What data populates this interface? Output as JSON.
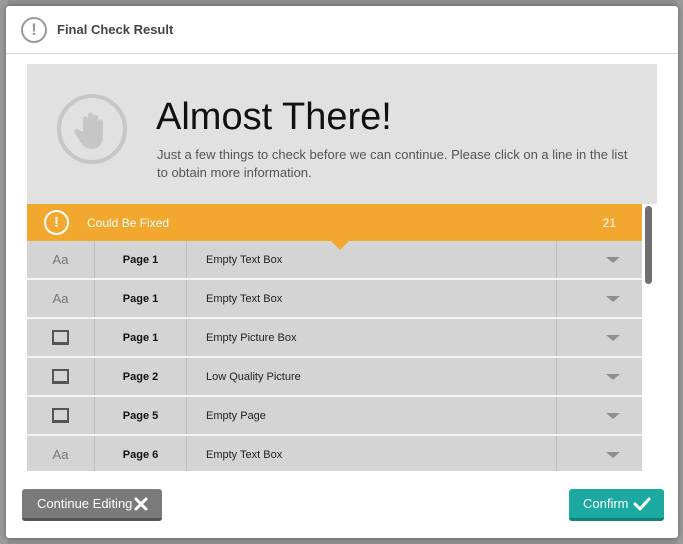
{
  "dialog": {
    "title": "Final Check Result",
    "title_icon": "exclamation-circle-icon"
  },
  "hero": {
    "heading": "Almost There!",
    "subtitle": "Just a few things to check before we can continue. Please click on a line in the list to obtain more information.",
    "icon": "stop-hand-icon"
  },
  "group": {
    "label": "Could Be Fixed",
    "count": "21",
    "icon": "exclamation-circle-icon",
    "color": "#f2a72e"
  },
  "rows": [
    {
      "type": "text",
      "type_label": "Aa",
      "page": "Page 1",
      "description": "Empty Text Box"
    },
    {
      "type": "text",
      "type_label": "Aa",
      "page": "Page 1",
      "description": "Empty Text Box"
    },
    {
      "type": "picture",
      "type_label": "",
      "page": "Page 1",
      "description": "Empty Picture Box"
    },
    {
      "type": "picture",
      "type_label": "",
      "page": "Page 2",
      "description": "Low Quality Picture"
    },
    {
      "type": "picture",
      "type_label": "",
      "page": "Page 5",
      "description": "Empty Page"
    },
    {
      "type": "text",
      "type_label": "Aa",
      "page": "Page 6",
      "description": "Empty Text Box"
    }
  ],
  "buttons": {
    "continue_label": "Continue Editing",
    "continue_icon": "close-icon",
    "confirm_label": "Confirm",
    "confirm_icon": "checkmark-icon"
  },
  "colors": {
    "accent_teal": "#1ba9a1",
    "warning_orange": "#f2a72e",
    "neutral_button": "#7a7a7a"
  }
}
